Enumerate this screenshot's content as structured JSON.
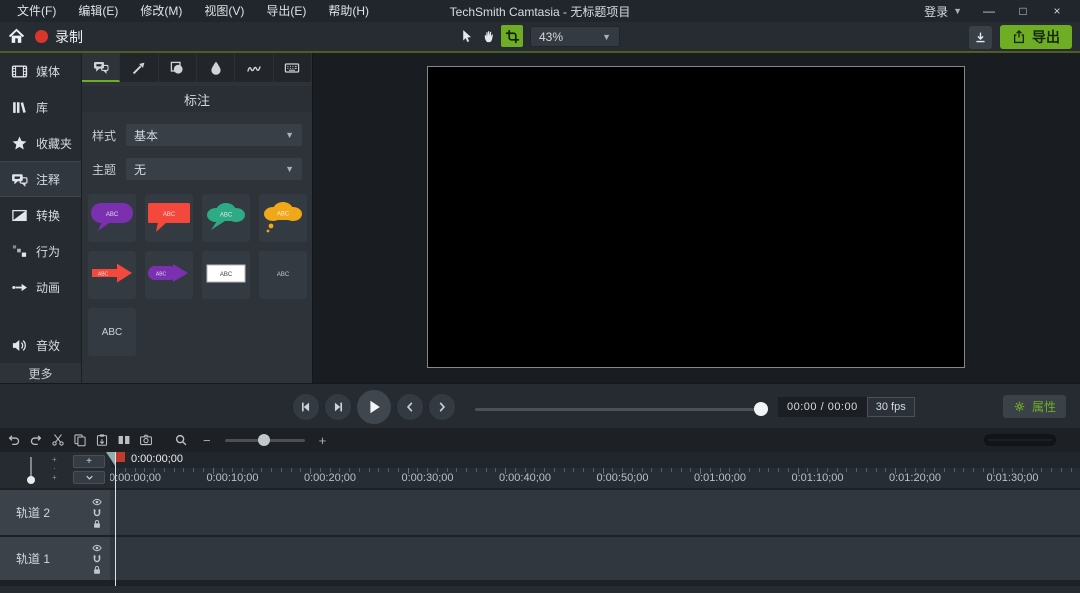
{
  "colors": {
    "accent": "#6fae24",
    "record_red": "#d9352b"
  },
  "title_bar": {
    "menus": [
      {
        "label": "文件(F)"
      },
      {
        "label": "编辑(E)"
      },
      {
        "label": "修改(M)"
      },
      {
        "label": "视图(V)"
      },
      {
        "label": "导出(E)"
      },
      {
        "label": "帮助(H)"
      }
    ],
    "title": "TechSmith Camtasia - 无标题项目",
    "login_label": "登录",
    "window_buttons": [
      {
        "name": "minimize",
        "glyph": "—"
      },
      {
        "name": "maximize",
        "glyph": "□"
      },
      {
        "name": "close",
        "glyph": "×"
      }
    ]
  },
  "toolbar": {
    "record_label": "录制",
    "tools": [
      {
        "name": "cursor",
        "icon": "cursor",
        "selected": false
      },
      {
        "name": "pan",
        "icon": "hand",
        "selected": false
      },
      {
        "name": "crop",
        "icon": "crop",
        "selected": true
      }
    ],
    "zoom_value": "43%",
    "export_label": "导出"
  },
  "sidebar": {
    "items": [
      {
        "label": "媒体",
        "icon": "media"
      },
      {
        "label": "库",
        "icon": "library"
      },
      {
        "label": "收藏夹",
        "icon": "star"
      },
      {
        "label": "注释",
        "icon": "annotation",
        "selected": true
      },
      {
        "label": "转换",
        "icon": "transition"
      },
      {
        "label": "行为",
        "icon": "behavior"
      },
      {
        "label": "动画",
        "icon": "animation"
      },
      {
        "label": "音效",
        "icon": "audio",
        "push": true
      }
    ],
    "more_label": "更多"
  },
  "panel": {
    "tabs": [
      {
        "name": "callouts",
        "icon": "callout",
        "selected": true
      },
      {
        "name": "arrows",
        "icon": "arrow"
      },
      {
        "name": "shapes",
        "icon": "shape"
      },
      {
        "name": "blur",
        "icon": "blur"
      },
      {
        "name": "sketch-motion",
        "icon": "sketch"
      },
      {
        "name": "keystroke",
        "icon": "keyboard"
      }
    ],
    "heading": "标注",
    "style_label": "样式",
    "style_value": "基本",
    "theme_label": "主题",
    "theme_value": "无",
    "callouts": [
      {
        "type": "bubble-round",
        "color": "#7b30b0",
        "label": "ABC"
      },
      {
        "type": "bubble-rect",
        "color": "#f4483d",
        "label": "ABC"
      },
      {
        "type": "cloud",
        "color": "#2eaa84",
        "label": "ABC"
      },
      {
        "type": "thought-cloud",
        "color": "#f0a718",
        "label": "ABC"
      },
      {
        "type": "arrow",
        "color": "#f4483d",
        "label": "ABC"
      },
      {
        "type": "arrow-pill",
        "color": "#7b30b0",
        "label": "ABC"
      },
      {
        "type": "text-box",
        "color": "#ffffff",
        "text_color": "#3a3f44",
        "label": "ABC"
      },
      {
        "type": "text-plain",
        "label": "ABC"
      },
      {
        "type": "text-large",
        "label": "ABC"
      }
    ]
  },
  "playback": {
    "transport": [
      {
        "name": "previous-frame",
        "icon": "step-back"
      },
      {
        "name": "next-frame",
        "icon": "step-forward"
      },
      {
        "name": "play",
        "icon": "play",
        "primary": true
      },
      {
        "name": "previous",
        "icon": "chevron-left"
      },
      {
        "name": "next",
        "icon": "chevron-right"
      }
    ],
    "time_display": "00:00 / 00:00",
    "fps_display": "30 fps",
    "properties_label": "属性"
  },
  "timeline_toolbar": {
    "buttons": [
      {
        "name": "undo"
      },
      {
        "name": "redo"
      },
      {
        "name": "cut"
      },
      {
        "name": "copy"
      },
      {
        "name": "paste"
      },
      {
        "name": "split"
      },
      {
        "name": "screenshot"
      }
    ],
    "zoom_out_glyph": "−",
    "zoom_in_glyph": "+"
  },
  "timeline": {
    "playhead_time": "0:00:00;00",
    "add_track_label": "+",
    "ruler_labels": [
      "0:00:00;00",
      "0:00:10;00",
      "0:00:20;00",
      "0:00:30;00",
      "0:00:40;00",
      "0:00:50;00",
      "0:01:00;00",
      "0:01:10;00",
      "0:01:20;00",
      "0:01:30;00"
    ],
    "tracks": [
      {
        "name": "轨道 2"
      },
      {
        "name": "轨道 1"
      }
    ],
    "track_icons": [
      "eye",
      "magnet",
      "lock"
    ]
  }
}
